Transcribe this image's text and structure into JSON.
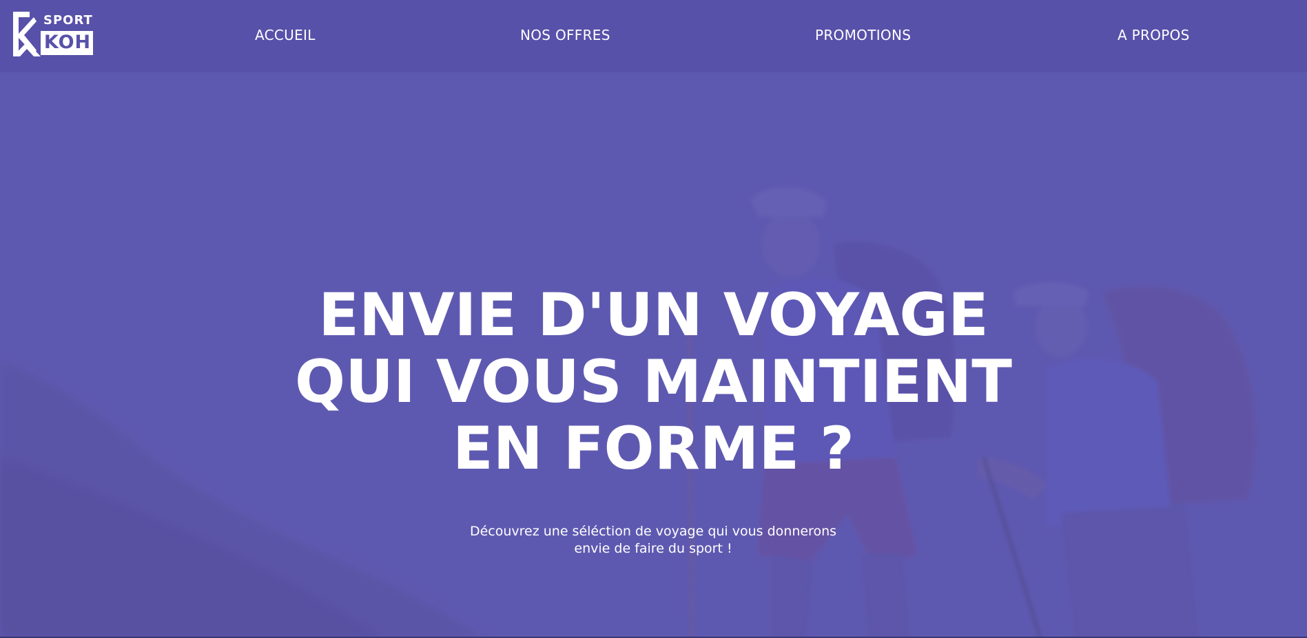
{
  "brand": {
    "logo_top": "SPORT",
    "logo_bottom": "KOH"
  },
  "nav": {
    "items": [
      {
        "label": "ACCUEIL"
      },
      {
        "label": "NOS OFFRES"
      },
      {
        "label": "PROMOTIONS"
      },
      {
        "label": "A PROPOS"
      }
    ]
  },
  "hero": {
    "title_lines": [
      "ENVIE D'UN VOYAGE",
      "QUI VOUS MAINTIENT",
      "EN FORME ?"
    ],
    "subtitle_lines": [
      "Découvrez une séléction de voyage qui vous donnerons",
      "envie de faire du sport !"
    ]
  },
  "colors": {
    "header_bg": "#5851a9",
    "hero_overlay": "#5e58b0",
    "text": "#ffffff"
  },
  "icons": {
    "logo_mark": "mountain-k-logo-icon"
  }
}
